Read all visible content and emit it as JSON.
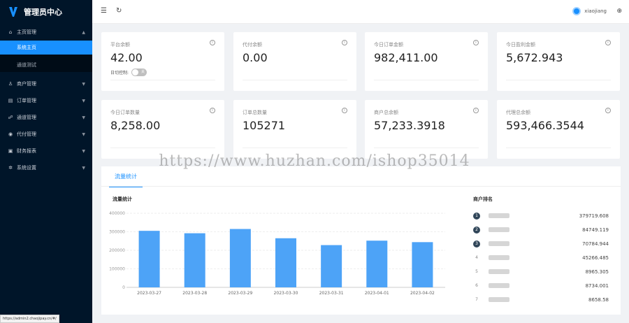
{
  "app": {
    "title": "管理员中心"
  },
  "sidebar": {
    "groups": [
      {
        "label": "主页管理",
        "icon": "home-icon",
        "expanded": true,
        "items": [
          {
            "label": "系统主页",
            "active": true
          },
          {
            "label": "通道测试",
            "active": false
          }
        ]
      },
      {
        "label": "商户管理",
        "icon": "user-icon"
      },
      {
        "label": "订单管理",
        "icon": "order-icon"
      },
      {
        "label": "通道管理",
        "icon": "channel-icon"
      },
      {
        "label": "代付管理",
        "icon": "payout-icon"
      },
      {
        "label": "财务报表",
        "icon": "report-icon"
      },
      {
        "label": "系统设置",
        "icon": "settings-icon"
      }
    ]
  },
  "header": {
    "username": "xiaojiang"
  },
  "cards": [
    {
      "label": "平台余额",
      "value": "42.00",
      "toggle_label": "日切控制:",
      "toggle_state": "关"
    },
    {
      "label": "代付余额",
      "value": "0.00"
    },
    {
      "label": "今日订单金额",
      "value": "982,411.00"
    },
    {
      "label": "今日盈利金额",
      "value": "5,672.943"
    },
    {
      "label": "今日订单数量",
      "value": "8,258.00"
    },
    {
      "label": "订单总数量",
      "value": "105271"
    },
    {
      "label": "商户总余额",
      "value": "57,233.3918"
    },
    {
      "label": "代理总余额",
      "value": "593,466.3544"
    }
  ],
  "panel": {
    "tab": "流量统计",
    "chart_title": "流量统计",
    "rank_title": "商户排名"
  },
  "chart_data": {
    "type": "bar",
    "title": "流量统计",
    "categories": [
      "2023-03-27",
      "2023-03-28",
      "2023-03-29",
      "2023-03-30",
      "2023-03-31",
      "2023-04-01",
      "2023-04-02"
    ],
    "values": [
      305000,
      292000,
      315000,
      265000,
      228000,
      252000,
      244000
    ],
    "ylim": [
      0,
      400000
    ],
    "y_ticks": [
      "0",
      "100000",
      "200000",
      "300000",
      "400000"
    ],
    "grid": true,
    "color": "#4da3f7"
  },
  "ranking": [
    {
      "rank": "1",
      "amount": "379719.608"
    },
    {
      "rank": "2",
      "amount": "84749.119"
    },
    {
      "rank": "3",
      "amount": "70784.944"
    },
    {
      "rank": "4",
      "amount": "45266.485"
    },
    {
      "rank": "5",
      "amount": "8965.305"
    },
    {
      "rank": "6",
      "amount": "8734.001"
    },
    {
      "rank": "7",
      "amount": "8658.58"
    }
  ],
  "watermark": "https://www.huzhan.com/ishop35014",
  "status_url": "https://admin2.chaojipay.cn/#/"
}
